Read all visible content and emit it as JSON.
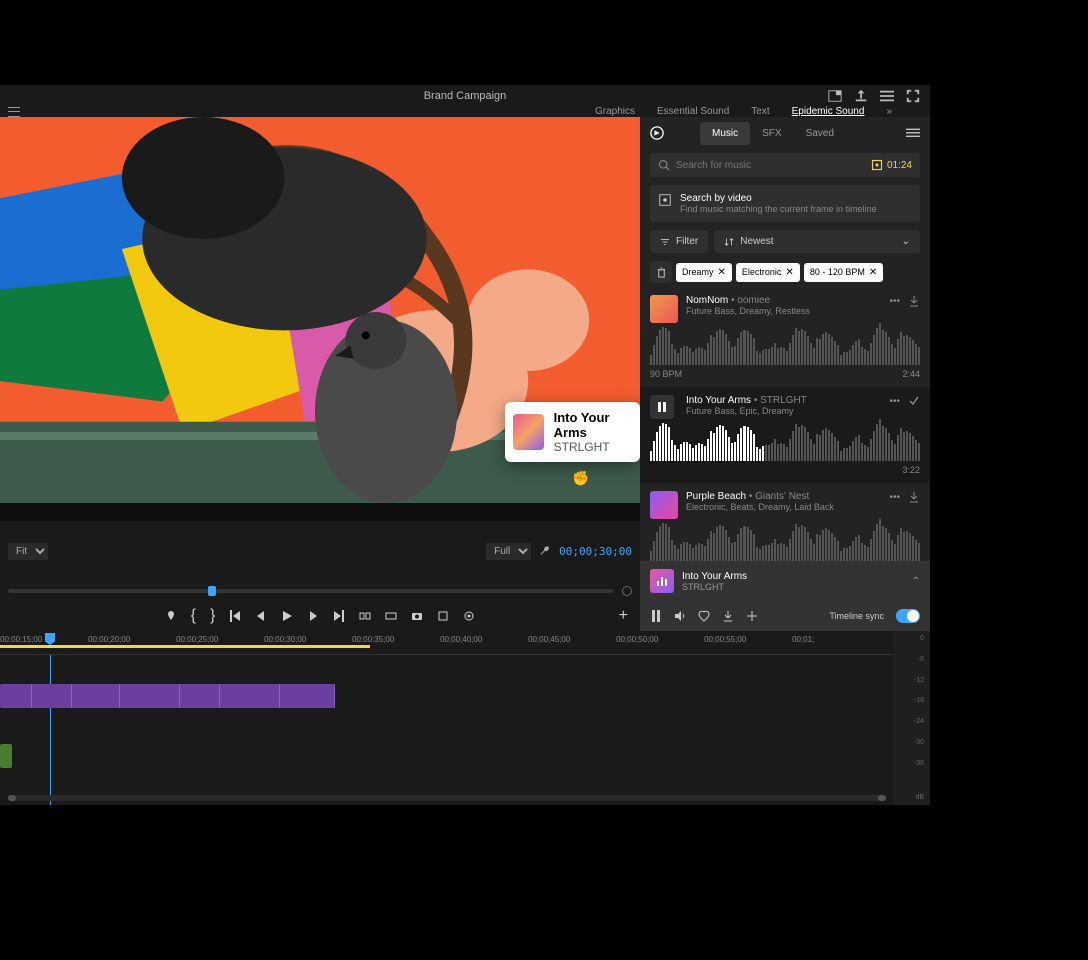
{
  "titlebar": {
    "title": "Brand Campaign"
  },
  "top_tabs": {
    "graphics": "Graphics",
    "essential_sound": "Essential Sound",
    "text": "Text",
    "epidemic": "Epidemic Sound"
  },
  "panel": {
    "tabs": {
      "music": "Music",
      "sfx": "SFX",
      "saved": "Saved"
    },
    "search_placeholder": "Search for music",
    "duration_badge": "01:24",
    "search_video": {
      "title": "Search by video",
      "subtitle": "Find music matching the current frame in timeline"
    },
    "filter_label": "Filter",
    "sort_label": "Newest",
    "chips": [
      "Dreamy",
      "Electronic",
      "80 - 120 BPM"
    ],
    "tracks": [
      {
        "title": "NomNom",
        "artist": "oomiee",
        "tags": "Future Bass, Dreamy, Restless",
        "bpm": "90 BPM",
        "dur": "2:44"
      },
      {
        "title": "Into Your Arms",
        "artist": "STRLGHT",
        "tags": "Future Bass, Epic, Dreamy",
        "bpm": "",
        "dur": "3:22"
      },
      {
        "title": "Purple Beach",
        "artist": "Giants' Nest",
        "tags": "Electronic, Beats, Dreamy, Laid Back",
        "bpm": "",
        "dur": ""
      }
    ],
    "now_playing": {
      "title": "Into Your Arms",
      "artist": "STRLGHT"
    },
    "timeline_sync": "Timeline sync"
  },
  "preview": {
    "fit_label": "Fit",
    "full_label": "Full",
    "timecode": "00;00;30;00"
  },
  "timeline": {
    "marks": [
      "00;00;15;00",
      "00;00;20;00",
      "00;00;25;00",
      "00;00;30;00",
      "00;00;35;00",
      "00;00;40;00",
      "00;00;45;00",
      "00;00;50;00",
      "00;00;55;00",
      "00;01;"
    ],
    "meter_marks": [
      "0",
      "-6",
      "-12",
      "-18",
      "-24",
      "-30",
      "-36",
      "",
      "dB"
    ]
  },
  "drag": {
    "title": "Into Your Arms",
    "artist": "STRLGHT"
  }
}
